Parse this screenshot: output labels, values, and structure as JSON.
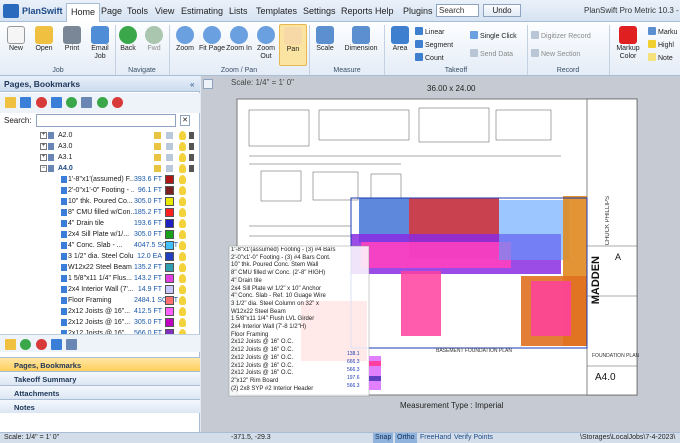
{
  "app": {
    "name": "PlanSwift",
    "title": "PlanSwift Pro Metric 10.3 - 7-4"
  },
  "menu": [
    "Home",
    "Page",
    "Tools",
    "View",
    "Estimating",
    "Lists",
    "Templates",
    "Settings",
    "Reports",
    "Help",
    "Plugins"
  ],
  "search": {
    "placeholder": "Search"
  },
  "undo": "Undo",
  "ribbon": {
    "new": "New",
    "open": "Open",
    "print": "Print",
    "email": "Email Job",
    "back": "Back",
    "fwd": "Fwd",
    "zoom": "Zoom",
    "fit_page": "Fit Page",
    "zoom_in": "Zoom In",
    "zoom_out": "Zoom Out",
    "pan": "Pan",
    "scale": "Scale",
    "dimension": "Dimension",
    "area": "Area",
    "linear": "Linear",
    "segment": "Segment",
    "count": "Count",
    "single_click": "Single Click",
    "send_data": "Send Data",
    "digitizer": "Digitizer Record",
    "new_section": "New Section",
    "markup_color": "Markup Color",
    "markup": "Marku",
    "highlight": "Highl",
    "note": "Note",
    "groups": {
      "job": "Job",
      "navigate": "Navigate",
      "zoom_pan": "Zoom / Pan",
      "measure": "Measure",
      "takeoff": "Takeoff",
      "record": "Record"
    }
  },
  "panel": {
    "title": "Pages, Bookmarks",
    "search_label": "Search:"
  },
  "pages": [
    {
      "label": "A2.0"
    },
    {
      "label": "A3.0"
    },
    {
      "label": "A3.1"
    },
    {
      "label": "A4.0"
    }
  ],
  "tree": [
    {
      "label": "1'-8\"x1'(assumed) F...",
      "value": "393.6",
      "unit": "FT",
      "color": "#b01818"
    },
    {
      "label": "2'-0\"x1'-0\" Footing - ...",
      "value": "96.1",
      "unit": "FT",
      "color": "#7a2020"
    },
    {
      "label": "10\" thk. Poured Co...",
      "value": "305.0",
      "unit": "FT",
      "color": "#e8e800"
    },
    {
      "label": "8\" CMU filled w/Con...",
      "value": "185.2",
      "unit": "FT",
      "color": "#ff2020"
    },
    {
      "label": "4\" Drain tile",
      "value": "193.6",
      "unit": "FT",
      "color": "#2020c0"
    },
    {
      "label": "2x4 Sill Plate w/1/...",
      "value": "305.0",
      "unit": "FT",
      "color": "#18a018"
    },
    {
      "label": "4\" Conc. Slab - ...",
      "value": "4047.5",
      "unit": "SQ FT",
      "color": "#40c0ff"
    },
    {
      "label": "3 1/2\" dia. Steel Colu...",
      "value": "12.0",
      "unit": "EA",
      "color": "#2040c0"
    },
    {
      "label": "W12x22 Steel Beam",
      "value": "135.2",
      "unit": "FT",
      "color": "#30a0b0"
    },
    {
      "label": "1 5/8\"x11 1/4\" Flus...",
      "value": "143.2",
      "unit": "FT",
      "color": "#e040e0"
    },
    {
      "label": "2x4 Interior Wall (7'...",
      "value": "14.9",
      "unit": "FT",
      "color": "#c8c8ff"
    },
    {
      "label": "Floor Framing",
      "value": "2484.1",
      "unit": "SQ FT",
      "color": "#ff7070"
    },
    {
      "label": "2x12 Joists @ 16\"...",
      "value": "412.5",
      "unit": "FT",
      "color": "#ff60ff"
    },
    {
      "label": "2x12 Joists @ 16\"...",
      "value": "305.0",
      "unit": "FT",
      "color": "#c000c0"
    },
    {
      "label": "2x12 Joists @ 16\"...",
      "value": "566.0",
      "unit": "FT",
      "color": "#8030c0"
    }
  ],
  "nav_panes": [
    "Pages, Bookmarks",
    "Takeoff Summary",
    "Attachments",
    "Notes"
  ],
  "canvas": {
    "scale_top": "Scale: 1/4\" = 1' 0\"",
    "sheet_size": "36.00 x 24.00",
    "measurement_type": "Measurement Type : Imperial",
    "overlay": [
      "1'-8\"x1'(assumed) Footing - (3) #4 Bars",
      "2'-0\"x1'-0\" Footing - (3) #4 Bars Cont.",
      "10\" thk. Poured Conc. Stem Wall",
      "8\" CMU filled w/ Conc. (2'-8\" HIGH)",
      "4\" Drain tile",
      "2x4 Sill Plate w/ 1/2\" x 10\" Anchor",
      "4\" Conc. Slab - Ref. 10 Guage Wire",
      "3 1/2\" dia. Steel Column on 32\" x",
      "W12x22 Steel Beam",
      "1 5/8\"x11 1/4\" Flush LVL Girder",
      "2x4 Interior Wall (7'-8 1/2\"H)",
      "Floor Framing",
      "2x12 Joists @ 16\" O.C.",
      "2x12 Joists @ 16\" O.C.",
      "2x12 Joists @ 16\" O.C.",
      "2x12 Joists @ 16\" O.C.",
      "2x12 Joists @ 16\" O.C.",
      "2\"x12\" Rim Board",
      "(2) 2x8 SYP #2 Interior Header"
    ],
    "overlay_values": [
      "138.1",
      "666.3",
      "566.3",
      "197.6",
      "566.3"
    ],
    "title_block": {
      "company": "MADDEN",
      "sheet": "A4.0",
      "sheet_title": "FOUNDATION PLAN",
      "designer": "CHUCK PHILLIPS",
      "section": "A",
      "plan_label": "BASEMENT FOUNDATION PLAN"
    }
  },
  "status": {
    "scale": "Scale: 1/4\" = 1' 0\"",
    "coords": "-371.5, -29.3",
    "snap": "Snap",
    "ortho": "Ortho",
    "freehand": "FreeHand",
    "verify": "Verify Points",
    "path": "\\Storages\\LocalJobs\\7-4-2023\\"
  }
}
